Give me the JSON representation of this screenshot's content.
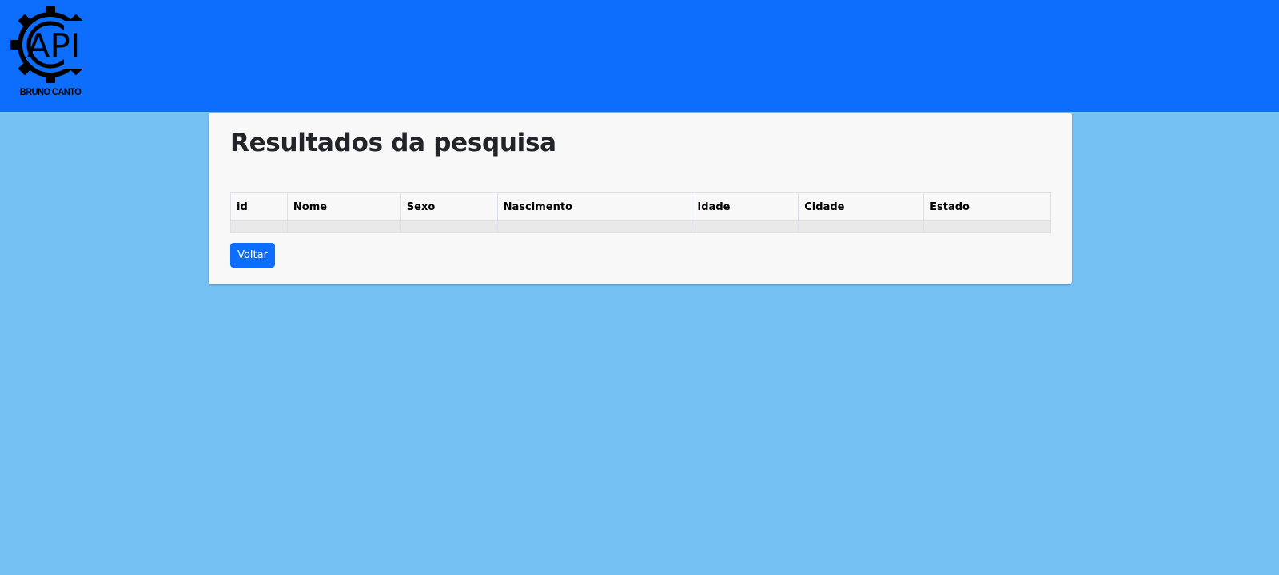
{
  "header": {
    "logo_text": "API",
    "logo_caption": "BRUNO CANTO",
    "background_color": "#0d6efd"
  },
  "page": {
    "background_color": "#76c1f4"
  },
  "card": {
    "title": "Resultados da pesquisa",
    "table": {
      "columns": [
        "id",
        "Nome",
        "Sexo",
        "Nascimento",
        "Idade",
        "Cidade",
        "Estado"
      ],
      "rows": []
    },
    "back_button": {
      "label": "Voltar",
      "color": "#0d6efd"
    }
  }
}
